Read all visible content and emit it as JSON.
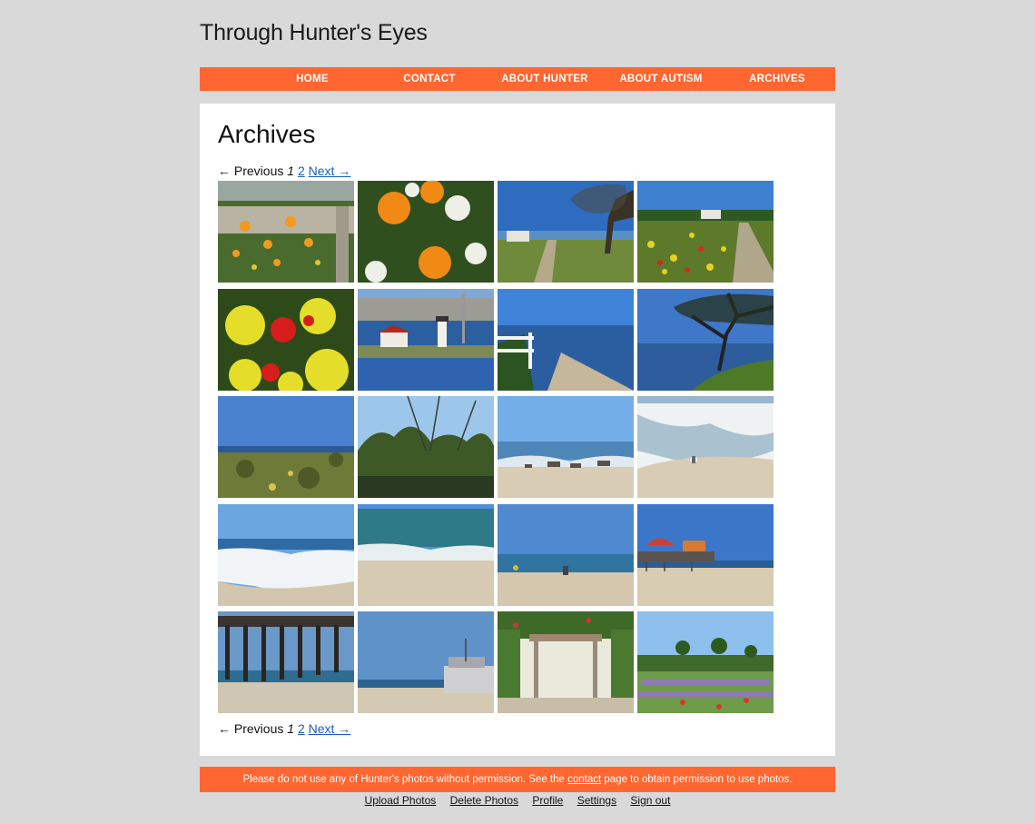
{
  "site": {
    "title": "Through Hunter's Eyes"
  },
  "nav": [
    {
      "label": "HOME"
    },
    {
      "label": "CONTACT"
    },
    {
      "label": "ABOUT HUNTER"
    },
    {
      "label": "ABOUT AUTISM"
    },
    {
      "label": "ARCHIVES"
    }
  ],
  "page": {
    "title": "Archives"
  },
  "pagination": {
    "previous": "← Previous",
    "current": "1",
    "page2": "2",
    "next": "Next →"
  },
  "photos": [
    {
      "scene": "poppies-fence"
    },
    {
      "scene": "poppies-closeup"
    },
    {
      "scene": "coast-path-tree"
    },
    {
      "scene": "wildflower-path"
    },
    {
      "scene": "red-yellow-flowers"
    },
    {
      "scene": "lighthouse"
    },
    {
      "scene": "shore-fence"
    },
    {
      "scene": "tree-over-water"
    },
    {
      "scene": "grassland-sea"
    },
    {
      "scene": "wooded-pond"
    },
    {
      "scene": "beach-rocks"
    },
    {
      "scene": "beach-gull"
    },
    {
      "scene": "surf-waves"
    },
    {
      "scene": "beach-waves"
    },
    {
      "scene": "beach-people"
    },
    {
      "scene": "pier-rides"
    },
    {
      "scene": "pier-underside"
    },
    {
      "scene": "pier-beach"
    },
    {
      "scene": "garden-pergola"
    },
    {
      "scene": "lavender-field"
    }
  ],
  "footer": {
    "notice_before": "Please do not use any of Hunter's photos without permission. See the ",
    "notice_link": "contact",
    "notice_after": " page to obtain permission to use photos."
  },
  "admin": [
    {
      "label": "Upload Photos"
    },
    {
      "label": "Delete Photos"
    },
    {
      "label": "Profile"
    },
    {
      "label": "Settings"
    },
    {
      "label": "Sign out"
    }
  ],
  "colors": {
    "accent": "#ff6630",
    "page_bg": "#d9d9d9",
    "link": "#1a5fb4"
  }
}
